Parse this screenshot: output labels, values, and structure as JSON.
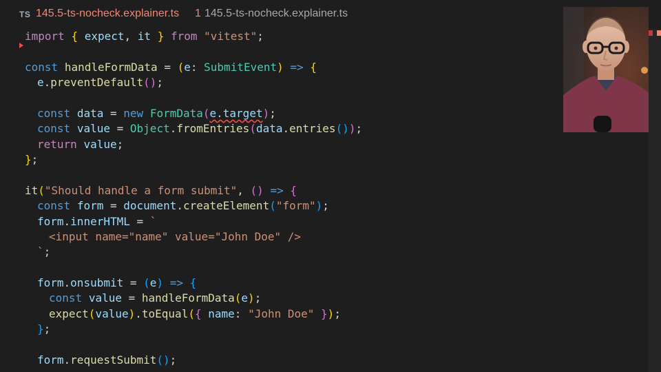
{
  "tab": {
    "icon_text": "TS",
    "title": "145.5-ts-nocheck.explainer.ts",
    "problem_count": "1",
    "path": "145.5-ts-nocheck.explainer.ts"
  },
  "code": {
    "l1": {
      "import": "import",
      "lbrace": "{",
      "expect": "expect",
      "comma": ",",
      "it": "it",
      "rbrace": "}",
      "from": "from",
      "mod": "\"vitest\"",
      "semi": ";"
    },
    "l3": {
      "const": "const",
      "name": "handleFormData",
      "eq": "=",
      "lp": "(",
      "e": "e",
      "colon": ":",
      "type": "SubmitEvent",
      "rp": ")",
      "arrow": "=>",
      "lb": "{"
    },
    "l4": {
      "e": "e",
      "dot": ".",
      "method": "preventDefault",
      "call": "()",
      "semi": ";"
    },
    "l6": {
      "const": "const",
      "name": "data",
      "eq": "=",
      "new": "new",
      "cls": "FormData",
      "lp": "(",
      "target": "e.target",
      "rp": ")",
      "semi": ";"
    },
    "l7": {
      "const": "const",
      "name": "value",
      "eq": "=",
      "obj": "Object",
      "dot": ".",
      "method": "fromEntries",
      "lp": "(",
      "data": "data",
      "dot2": ".",
      "entries": "entries",
      "call": "()",
      "rp": ")",
      "semi": ";"
    },
    "l8": {
      "return": "return",
      "value": "value",
      "semi": ";"
    },
    "l9": {
      "rb": "}",
      "semi": ";"
    },
    "l11": {
      "it": "it",
      "lp": "(",
      "str": "\"Should handle a form submit\"",
      "comma": ",",
      "args": "()",
      "arrow": "=>",
      "lb": "{"
    },
    "l12": {
      "const": "const",
      "name": "form",
      "eq": "=",
      "doc": "document",
      "dot": ".",
      "method": "createElement",
      "lp": "(",
      "str": "\"form\"",
      "rp": ")",
      "semi": ";"
    },
    "l13": {
      "form": "form",
      "dot": ".",
      "prop": "innerHTML",
      "eq": "=",
      "tick": "`"
    },
    "l14": {
      "str": "<input name=\"name\" value=\"John Doe\" />"
    },
    "l15": {
      "tick": "`",
      "semi": ";"
    },
    "l17": {
      "form": "form",
      "dot": ".",
      "prop": "onsubmit",
      "eq": "=",
      "lp": "(",
      "e": "e",
      "rp": ")",
      "arrow": "=>",
      "lb": "{"
    },
    "l18": {
      "const": "const",
      "name": "value",
      "eq": "=",
      "fn": "handleFormData",
      "lp": "(",
      "e": "e",
      "rp": ")",
      "semi": ";"
    },
    "l19": {
      "expect": "expect",
      "lp": "(",
      "value": "value",
      "rp": ")",
      "dot": ".",
      "method": "toEqual",
      "lp2": "(",
      "lb": "{",
      "key": "name",
      "colon": ":",
      "str": "\"John Doe\"",
      "rb": "}",
      "rp2": ")",
      "semi": ";"
    },
    "l20": {
      "rb": "}",
      "semi": ";"
    },
    "l22": {
      "form": "form",
      "dot": ".",
      "method": "requestSubmit",
      "call": "()",
      "semi": ";"
    }
  },
  "colors": {
    "background": "#1e1e1e",
    "error": "#f48771",
    "keyword": "#c586c0",
    "function": "#dcdcaa",
    "variable": "#9cdcfe",
    "string": "#ce9178",
    "type": "#4ec9b0"
  },
  "icons": {
    "code_action": "error-lightbulb-icon",
    "webcam": "presenter-webcam"
  }
}
